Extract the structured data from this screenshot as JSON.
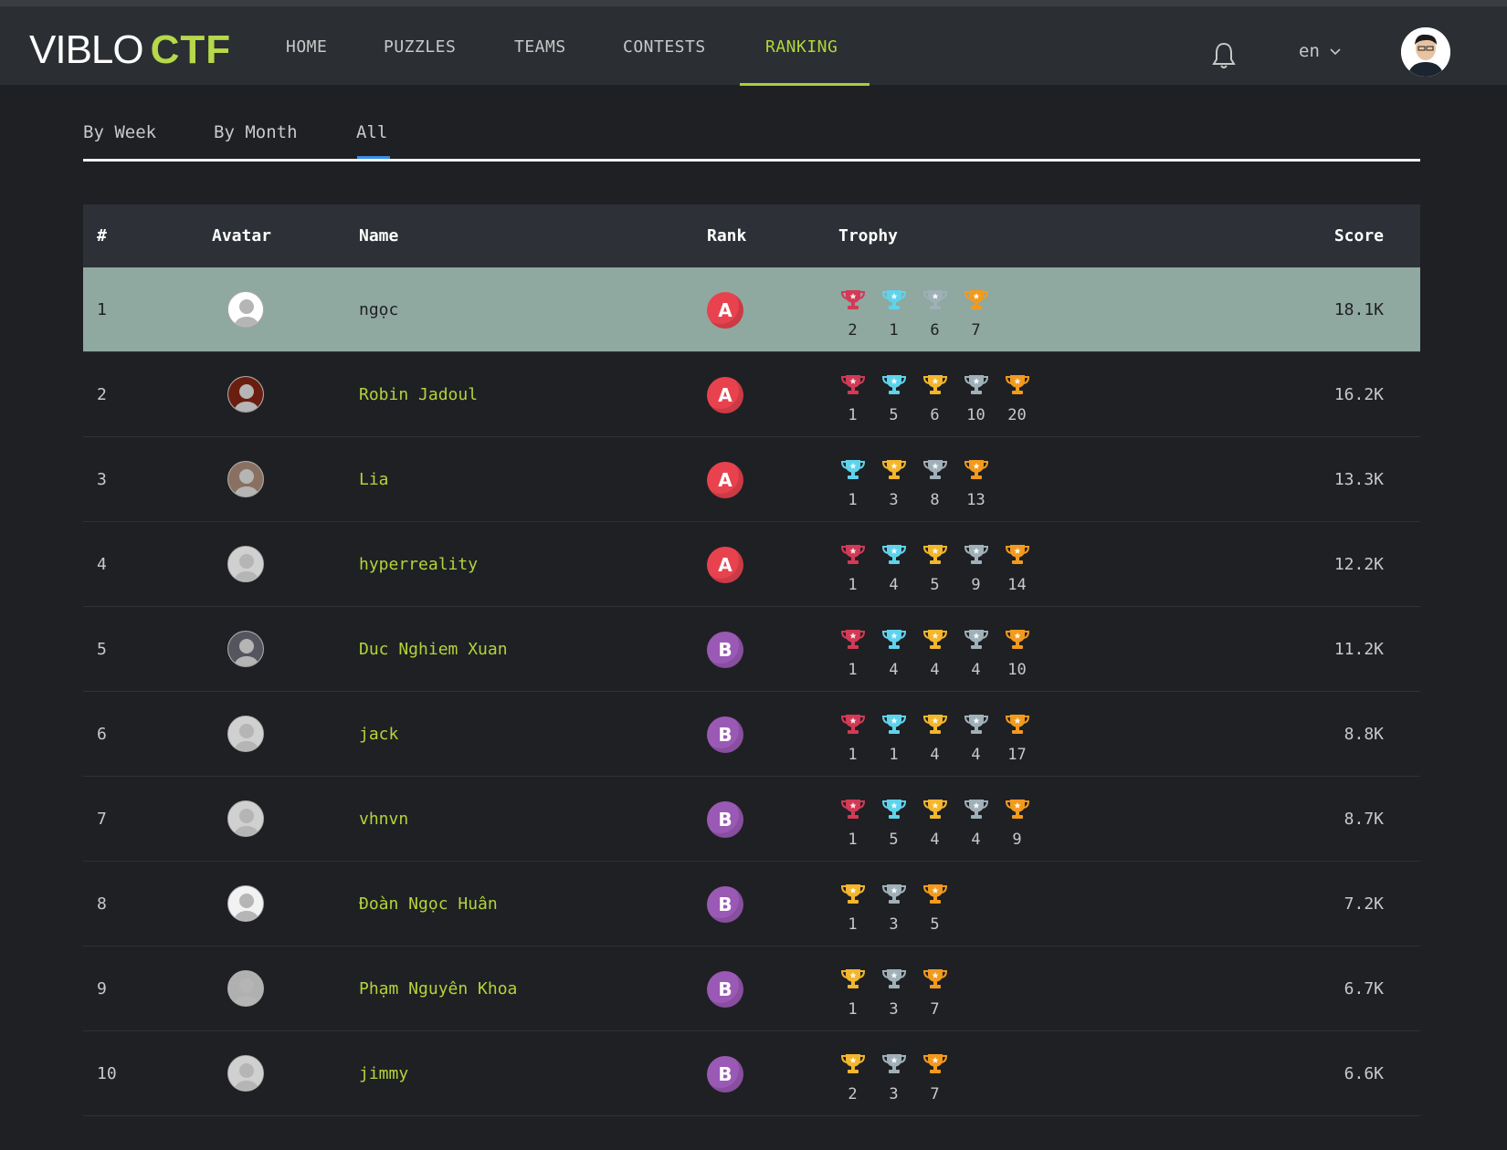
{
  "logo": {
    "viblo": "VIBLO",
    "ctf": "CTF"
  },
  "nav": {
    "items": [
      {
        "label": "HOME"
      },
      {
        "label": "PUZZLES"
      },
      {
        "label": "TEAMS"
      },
      {
        "label": "CONTESTS"
      },
      {
        "label": "RANKING",
        "active": true
      }
    ],
    "language": "en"
  },
  "tabs": [
    {
      "label": "By Week"
    },
    {
      "label": "By Month"
    },
    {
      "label": "All",
      "active": true
    }
  ],
  "table": {
    "headers": {
      "num": "#",
      "avatar": "Avatar",
      "name": "Name",
      "rank": "Rank",
      "trophy": "Trophy",
      "score": "Score"
    },
    "rows": [
      {
        "num": "1",
        "name": "ngọc",
        "rank": "A",
        "score": "18.1K",
        "avatar_color": "#ffffff",
        "trophies": [
          {
            "type": "red",
            "count": "2"
          },
          {
            "type": "cyan",
            "count": "1"
          },
          {
            "type": "silver",
            "count": "6"
          },
          {
            "type": "orange",
            "count": "7"
          }
        ]
      },
      {
        "num": "2",
        "name": "Robin Jadoul",
        "rank": "A",
        "score": "16.2K",
        "avatar_color": "#6a1e10",
        "trophies": [
          {
            "type": "red",
            "count": "1"
          },
          {
            "type": "cyan",
            "count": "5"
          },
          {
            "type": "gold",
            "count": "6"
          },
          {
            "type": "silver",
            "count": "10"
          },
          {
            "type": "orange",
            "count": "20"
          }
        ]
      },
      {
        "num": "3",
        "name": "Lia",
        "rank": "A",
        "score": "13.3K",
        "avatar_color": "#8a7060",
        "trophies": [
          {
            "type": "cyan",
            "count": "1"
          },
          {
            "type": "gold",
            "count": "3"
          },
          {
            "type": "silver",
            "count": "8"
          },
          {
            "type": "orange",
            "count": "13"
          }
        ]
      },
      {
        "num": "4",
        "name": "hyperreality",
        "rank": "A",
        "score": "12.2K",
        "avatar_color": "#d0d0d0",
        "trophies": [
          {
            "type": "red",
            "count": "1"
          },
          {
            "type": "cyan",
            "count": "4"
          },
          {
            "type": "gold",
            "count": "5"
          },
          {
            "type": "silver",
            "count": "9"
          },
          {
            "type": "orange",
            "count": "14"
          }
        ]
      },
      {
        "num": "5",
        "name": "Duc Nghiem Xuan",
        "rank": "B",
        "score": "11.2K",
        "avatar_color": "#55555f",
        "trophies": [
          {
            "type": "red",
            "count": "1"
          },
          {
            "type": "cyan",
            "count": "4"
          },
          {
            "type": "gold",
            "count": "4"
          },
          {
            "type": "silver",
            "count": "4"
          },
          {
            "type": "orange",
            "count": "10"
          }
        ]
      },
      {
        "num": "6",
        "name": "jack",
        "rank": "B",
        "score": "8.8K",
        "avatar_color": "#d0d0d0",
        "trophies": [
          {
            "type": "red",
            "count": "1"
          },
          {
            "type": "cyan",
            "count": "1"
          },
          {
            "type": "gold",
            "count": "4"
          },
          {
            "type": "silver",
            "count": "4"
          },
          {
            "type": "orange",
            "count": "17"
          }
        ]
      },
      {
        "num": "7",
        "name": "vhnvn",
        "rank": "B",
        "score": "8.7K",
        "avatar_color": "#d0d0d0",
        "trophies": [
          {
            "type": "red",
            "count": "1"
          },
          {
            "type": "cyan",
            "count": "5"
          },
          {
            "type": "gold",
            "count": "4"
          },
          {
            "type": "silver",
            "count": "4"
          },
          {
            "type": "orange",
            "count": "9"
          }
        ]
      },
      {
        "num": "8",
        "name": "Đoàn Ngọc Huân",
        "rank": "B",
        "score": "7.2K",
        "avatar_color": "#f2f2f2",
        "trophies": [
          {
            "type": "gold",
            "count": "1"
          },
          {
            "type": "silver",
            "count": "3"
          },
          {
            "type": "orange",
            "count": "5"
          }
        ]
      },
      {
        "num": "9",
        "name": "Phạm Nguyên Khoa",
        "rank": "B",
        "score": "6.7K",
        "avatar_color": "#b0b0b0",
        "trophies": [
          {
            "type": "gold",
            "count": "1"
          },
          {
            "type": "silver",
            "count": "3"
          },
          {
            "type": "orange",
            "count": "7"
          }
        ]
      },
      {
        "num": "10",
        "name": "jimmy",
        "rank": "B",
        "score": "6.6K",
        "avatar_color": "#d0d0d0",
        "trophies": [
          {
            "type": "gold",
            "count": "2"
          },
          {
            "type": "silver",
            "count": "3"
          },
          {
            "type": "orange",
            "count": "7"
          }
        ]
      }
    ]
  },
  "colors": {
    "accent": "#b0d63c",
    "rank_A": "#e8424f",
    "rank_B": "#9b59b6",
    "highlight_row": "#8fa8a0",
    "trophy_red": "#d23a55",
    "trophy_cyan": "#5fd3ec",
    "trophy_gold": "#f3b62c",
    "trophy_silver": "#9fb0b8",
    "trophy_orange": "#f29a1e"
  }
}
